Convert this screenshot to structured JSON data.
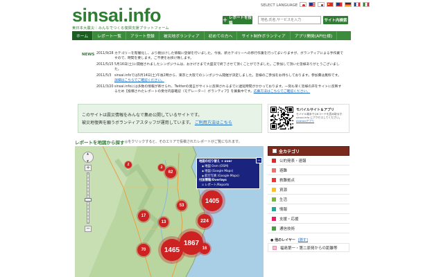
{
  "header": {
    "logo": "sinsai.info",
    "tagline": "東日本大震災｜みんなでつくる復興支援プラットフォーム",
    "select_language": "SELECT LANGUAGE",
    "flags": [
      "jp",
      "us",
      "kr",
      "cn",
      "tw",
      "de",
      "fr",
      "it"
    ],
    "report_button": "レポートを投稿",
    "search_placeholder": "地名,氏名,サービスを入力",
    "search_button": "サイト内検索"
  },
  "nav": {
    "items": [
      "ホーム",
      "レポート一覧",
      "アラート登録",
      "被災地ボランティア",
      "初めての方へ",
      "サイト制作ボランティア",
      "アプリ開発(API仕様)"
    ]
  },
  "news": {
    "label": "NEWS",
    "items": [
      {
        "date": "2011/9/28",
        "text": "カテゴリーを階層化し、より親分けした情報に登録を行いました。今後、新カテゴリーへの移行作業を行ってまいりますが、ボランティアによる手作業ですので、時間を要します。ご不便をお掛け致します。"
      },
      {
        "date": "2011/5/15",
        "text": "5月16日(土)に開催されましたシンポジウムは、おかげさまで大盛況で終了させて頂くことができました。ご参加して頂いた皆様ありがとうございました。"
      },
      {
        "date": "2011/5/3",
        "text": "sinsai.infoでは5月14日(土)午後2時から、東京と大阪でのシンポジウム開催が決定しました。皆様のご参加をお待ちしております。参加費は無料です。",
        "link": "詳細はこちらでご確認ください。"
      },
      {
        "date": "2011/3/20",
        "text": "sinsai.infoには多数の情報が寄せられ、Twitterの発言がサイトに反映されるまでに遅延時間がかかっております。一刻も早く皆様の声をサイトに反映するため【投稿されたレポートの受付内容確認（モデレーター）ボランティア】を募集中です。",
        "link": "応募方法はこちらでご確認ください。"
      }
    ]
  },
  "info": {
    "line1": "このサイトは震災情報をみんなで集め公開しているサイトです。",
    "line2": "被災地復興を願うボランティアスタッフが運用しています。",
    "link": "ご利用方法はこちら"
  },
  "mobile": {
    "title": "モバイルサイト＆アプリ",
    "text": "モバイル端末でQRコードを読み取るか sinsai.info にアクセスしてください。",
    "link": "Androidアプリ"
  },
  "map": {
    "title": "レポートを地図から探す",
    "subtitle": "◎をクリックすると、そのエリアで投稿されたレポートがご覧になれます。",
    "clusters": [
      {
        "label": "2",
        "color": "#cc2222"
      },
      {
        "label": "2",
        "color": "#cc2222"
      },
      {
        "label": "62",
        "color": "#cc2222"
      },
      {
        "label": "1405",
        "color": "#cc2222"
      },
      {
        "label": "53",
        "color": "#cc2222"
      },
      {
        "label": "17",
        "color": "#cc2222"
      },
      {
        "label": "13",
        "color": "#cc2222"
      },
      {
        "label": "224",
        "color": "#cc2222"
      },
      {
        "label": "1867",
        "color": "#cc2222"
      },
      {
        "label": "70",
        "color": "#cc2222"
      },
      {
        "label": "1465",
        "color": "#cc2222"
      },
      {
        "label": "16",
        "color": "#cc2222"
      }
    ],
    "layer_box": {
      "title": "地図の切り替え",
      "title_suffix": "+ over",
      "items": [
        "地図 Osm (OSM)",
        "地図 (Google Maps)",
        "航空写真 (Google Maps)"
      ],
      "overlay_title": "付加情報/Overlays",
      "overlay_item": "レポート/Reports"
    }
  },
  "categories": {
    "header": "全カテゴリ",
    "items": [
      {
        "label": "公的発表・速報",
        "color": "#d32f2f"
      },
      {
        "label": "避難",
        "color": "#e57373"
      },
      {
        "label": "救難拠点",
        "color": "#e53935"
      },
      {
        "label": "資源",
        "color": "#fbc02d"
      },
      {
        "label": "生活",
        "color": "#7cb342"
      },
      {
        "label": "情報",
        "color": "#26a69a"
      },
      {
        "label": "支援・応援",
        "color": "#e91e63"
      },
      {
        "label": "通信技術",
        "color": "#43a047"
      }
    ],
    "layer_title": "● 他のレイヤー",
    "layer_toggle": "[隠す]",
    "layer_items": [
      "福島第一・第二原発からの距離等"
    ]
  }
}
